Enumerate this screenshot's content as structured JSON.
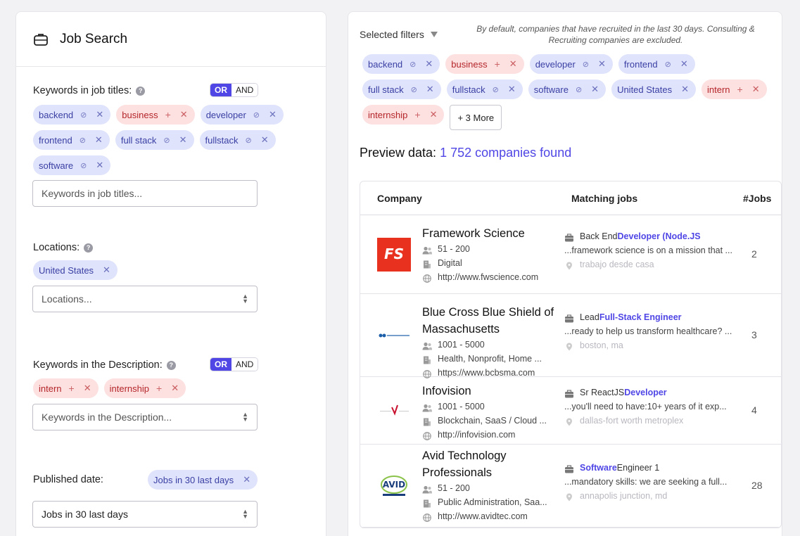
{
  "left": {
    "title": "Job Search",
    "titles_section": {
      "label": "Keywords in job titles:",
      "or": "OR",
      "and": "AND",
      "chips": [
        {
          "label": "backend",
          "kind": "blue"
        },
        {
          "label": "business",
          "kind": "red"
        },
        {
          "label": "developer",
          "kind": "blue"
        },
        {
          "label": "frontend",
          "kind": "blue"
        },
        {
          "label": "full stack",
          "kind": "blue"
        },
        {
          "label": "fullstack",
          "kind": "blue"
        },
        {
          "label": "software",
          "kind": "blue"
        }
      ],
      "placeholder": "Keywords in job titles..."
    },
    "locations": {
      "label": "Locations:",
      "chip": "United States",
      "placeholder": "Locations..."
    },
    "description": {
      "label": "Keywords in the Description:",
      "or": "OR",
      "and": "AND",
      "chips": [
        "intern",
        "internship"
      ],
      "placeholder": "Keywords in the Description..."
    },
    "published": {
      "label": "Published date:",
      "chip": "Jobs in 30 last days",
      "value": "Jobs in 30 last days"
    }
  },
  "right": {
    "filters_label": "Selected filters",
    "note": "By default, companies that have recruited in the last 30 days. Consulting & Recruiting companies are excluded.",
    "chips": [
      {
        "label": "backend",
        "kind": "blue",
        "icon": true
      },
      {
        "label": "business",
        "kind": "red",
        "icon": true
      },
      {
        "label": "developer",
        "kind": "blue",
        "icon": true
      },
      {
        "label": "frontend",
        "kind": "blue",
        "icon": true
      },
      {
        "label": "full stack",
        "kind": "blue",
        "icon": true
      },
      {
        "label": "fullstack",
        "kind": "blue",
        "icon": true
      },
      {
        "label": "software",
        "kind": "blue",
        "icon": true
      },
      {
        "label": "United States",
        "kind": "blue",
        "icon": false
      },
      {
        "label": "intern",
        "kind": "red",
        "icon": true
      },
      {
        "label": "internship",
        "kind": "red",
        "icon": true
      }
    ],
    "more": "+ 3 More",
    "preview_label": "Preview data:",
    "preview_count": "1 752 companies found",
    "columns": {
      "company": "Company",
      "matching": "Matching jobs",
      "jobs": "#Jobs"
    },
    "rows": [
      {
        "name": "Framework Science",
        "size": "51 - 200",
        "industry": "Digital",
        "url": "http://www.fwscience.com",
        "job_prefix": "Back End ",
        "job_highlight": "Developer (Node.JS",
        "snippet": "...framework science is on a mission that ...",
        "location": "trabajo desde casa",
        "count": "2",
        "logo": "fs"
      },
      {
        "name": "Blue Cross Blue Shield of Massachusetts",
        "size": "1001 - 5000",
        "industry": "Health, Nonprofit, Home ...",
        "url": "https://www.bcbsma.com",
        "job_prefix": "Lead ",
        "job_highlight": "Full-Stack Engineer",
        "snippet": "...ready to help us transform healthcare? ...",
        "location": "boston, ma",
        "count": "3",
        "logo": "bcbs"
      },
      {
        "name": "Infovision",
        "size": "1001 - 5000",
        "industry": "Blockchain, SaaS / Cloud ...",
        "url": "http://infovision.com",
        "job_prefix": "Sr ReactJS ",
        "job_highlight": "Developer",
        "snippet": "...you'll need to have:10+ years of it exp...",
        "location": "dallas-fort worth metroplex",
        "count": "4",
        "logo": "info"
      },
      {
        "name": "Avid Technology Professionals",
        "size": "51 - 200",
        "industry": "Public Administration, Saa...",
        "url": "http://www.avidtec.com",
        "job_prefix": "",
        "job_highlight": "Software",
        "job_suffix": " Engineer 1",
        "snippet": "...mandatory skills: we are seeking a full...",
        "location": "annapolis junction, md",
        "count": "28",
        "logo": "avid"
      }
    ]
  }
}
